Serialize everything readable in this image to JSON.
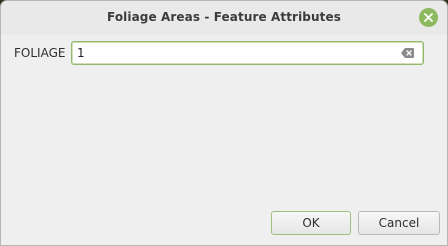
{
  "window": {
    "title": "Foliage Areas - Feature Attributes"
  },
  "icons": {
    "close": "close-icon",
    "clear": "clear-text-icon"
  },
  "colors": {
    "accent": "#8dba5e",
    "focus_border": "#93b76b"
  },
  "form": {
    "fields": [
      {
        "label": "FOLIAGE",
        "value": "1"
      }
    ]
  },
  "buttons": {
    "ok": "OK",
    "cancel": "Cancel"
  }
}
